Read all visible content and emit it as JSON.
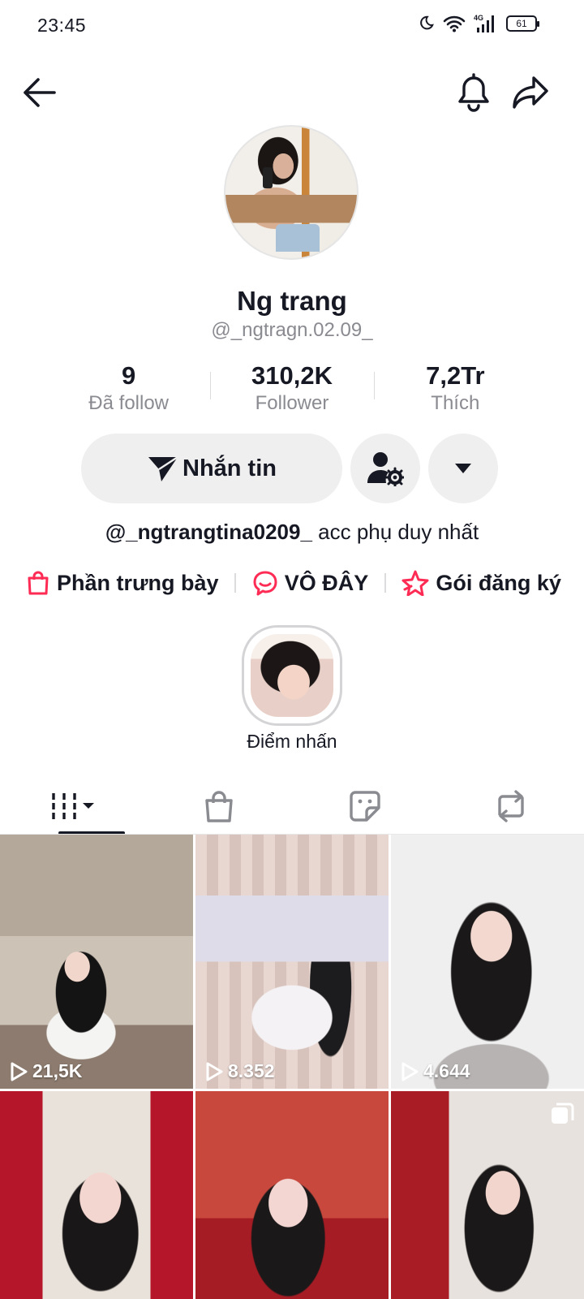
{
  "status_bar": {
    "time": "23:45",
    "battery": "61"
  },
  "profile": {
    "display_name": "Ng trang",
    "username": "@_ngtragn.02.09_"
  },
  "stats": [
    {
      "value": "9",
      "label": "Đã follow"
    },
    {
      "value": "310,2K",
      "label": "Follower"
    },
    {
      "value": "7,2Tr",
      "label": "Thích"
    }
  ],
  "actions": {
    "message_label": "Nhắn tin"
  },
  "bio": {
    "handle": "@_ngtrangtina0209_",
    "text": " acc phụ duy nhất"
  },
  "links": [
    {
      "label": "Phần trưng bày",
      "icon": "shopping-bag-icon"
    },
    {
      "label": "VÔ ĐÂY",
      "icon": "chat-bubble-icon"
    },
    {
      "label": "Gói đăng ký",
      "icon": "star-badge-icon"
    }
  ],
  "highlight": {
    "label": "Điểm nhấn"
  },
  "tabs": [
    {
      "icon": "videos-grid-icon",
      "active": true
    },
    {
      "icon": "shop-bag-icon",
      "active": false
    },
    {
      "icon": "favorites-icon",
      "active": false
    },
    {
      "icon": "repost-icon",
      "active": false
    }
  ],
  "videos": [
    {
      "views": "21,5K"
    },
    {
      "views": "8.352"
    },
    {
      "views": "4.644"
    },
    {
      "views": "",
      "multi_photo": false
    },
    {
      "views": ""
    },
    {
      "views": "",
      "multi_photo": true
    }
  ],
  "colors": {
    "accent": "#fe2c55",
    "text": "#161823",
    "muted": "#8a8b91",
    "button_bg": "#efefef"
  }
}
